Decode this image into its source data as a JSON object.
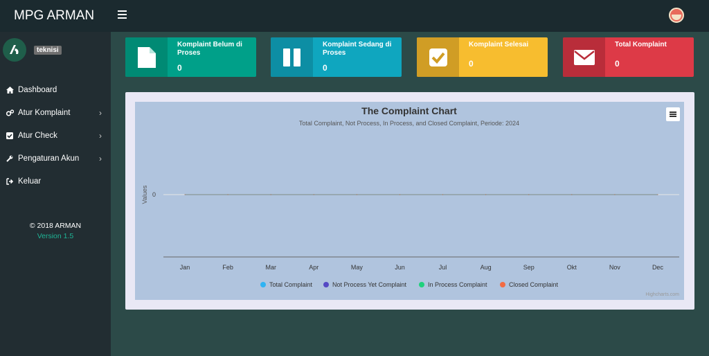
{
  "app": {
    "brand": "MPG ARMAN"
  },
  "header": {
    "menu_icon": "hamburger-icon",
    "avatar_icon": "user-avatar-icon"
  },
  "sidebar": {
    "role": "teknisi",
    "items": [
      {
        "label": "Dashboard",
        "icon": "home-icon",
        "has_submenu": false
      },
      {
        "label": "Atur Komplaint",
        "icon": "cogs-icon",
        "has_submenu": true
      },
      {
        "label": "Atur Check",
        "icon": "check-square-icon",
        "has_submenu": true
      },
      {
        "label": "Pengaturan Akun",
        "icon": "wrench-icon",
        "has_submenu": true
      },
      {
        "label": "Keluar",
        "icon": "sign-out-icon",
        "has_submenu": false
      }
    ],
    "copyright": "© 2018 ARMAN",
    "version": "Version 1.5"
  },
  "stats": [
    {
      "label": "Komplaint Belum di Proses",
      "value": "0",
      "icon": "file-icon",
      "color": "#00a089",
      "icon_bg": "#008a74"
    },
    {
      "label": "Komplaint Sedang di Proses",
      "value": "0",
      "icon": "pause-icon",
      "color": "#0fa6bf",
      "icon_bg": "#0d8ea4"
    },
    {
      "label": "Komplaint Selesai",
      "value": "0",
      "icon": "check-icon",
      "color": "#f7bd2f",
      "icon_bg": "#d09d25"
    },
    {
      "label": "Total Komplaint",
      "value": "0",
      "icon": "envelope-icon",
      "color": "#dd3a47",
      "icon_bg": "#b92d3a"
    }
  ],
  "chart_data": {
    "type": "line",
    "title": "The Complaint Chart",
    "subtitle": "Total Complaint, Not Process, In Process, and Closed Complaint, Periode: 2024",
    "ylabel": "Values",
    "yticks": [
      "0"
    ],
    "categories": [
      "Jan",
      "Feb",
      "Mar",
      "Apr",
      "May",
      "Jun",
      "Jul",
      "Aug",
      "Sep",
      "Okt",
      "Nov",
      "Dec"
    ],
    "series": [
      {
        "name": "Total Complaint",
        "color": "#2fb3f3",
        "values": [
          0,
          0,
          0,
          0,
          0,
          0,
          0,
          0,
          0,
          0,
          0,
          0
        ]
      },
      {
        "name": "Not Process Yet Complaint",
        "color": "#5549c4",
        "values": [
          0,
          0,
          0,
          0,
          0,
          0,
          0,
          0,
          0,
          0,
          0,
          0
        ]
      },
      {
        "name": "In Process Complaint",
        "color": "#1fd17c",
        "values": [
          0,
          0,
          0,
          0,
          0,
          0,
          0,
          0,
          0,
          0,
          0,
          0
        ]
      },
      {
        "name": "Closed Complaint",
        "color": "#f26b43",
        "values": [
          0,
          0,
          0,
          0,
          0,
          0,
          0,
          0,
          0,
          0,
          0,
          0
        ]
      }
    ],
    "legend_position": "bottom-center",
    "background": "#b0c4de",
    "credits": "Highcharts.com"
  }
}
